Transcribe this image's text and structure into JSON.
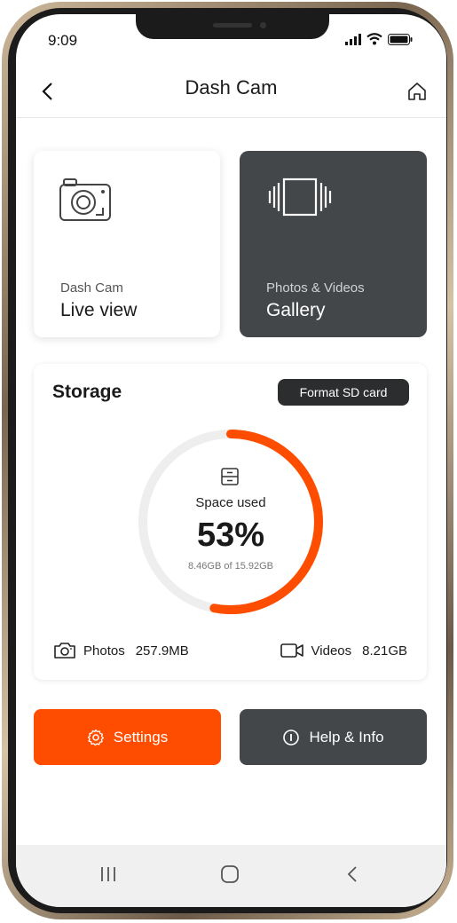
{
  "status": {
    "time": "9:09"
  },
  "header": {
    "title": "Dash Cam"
  },
  "cards": {
    "live": {
      "subtitle": "Dash Cam",
      "title": "Live view",
      "icon": "camera-icon"
    },
    "gallery": {
      "subtitle": "Photos & Videos",
      "title": "Gallery",
      "icon": "gallery-icon"
    }
  },
  "storage": {
    "title": "Storage",
    "format_label": "Format SD card",
    "used_label": "Space used",
    "percent_text": "53%",
    "percent_value": 53,
    "detail": "8.46GB of 15.92GB",
    "photos_label": "Photos",
    "photos_value": "257.9MB",
    "videos_label": "Videos",
    "videos_value": "8.21GB"
  },
  "actions": {
    "settings_label": "Settings",
    "help_label": "Help & Info"
  },
  "colors": {
    "accent": "#ff4d00",
    "dark": "#43474a",
    "track": "#eeeeee"
  }
}
